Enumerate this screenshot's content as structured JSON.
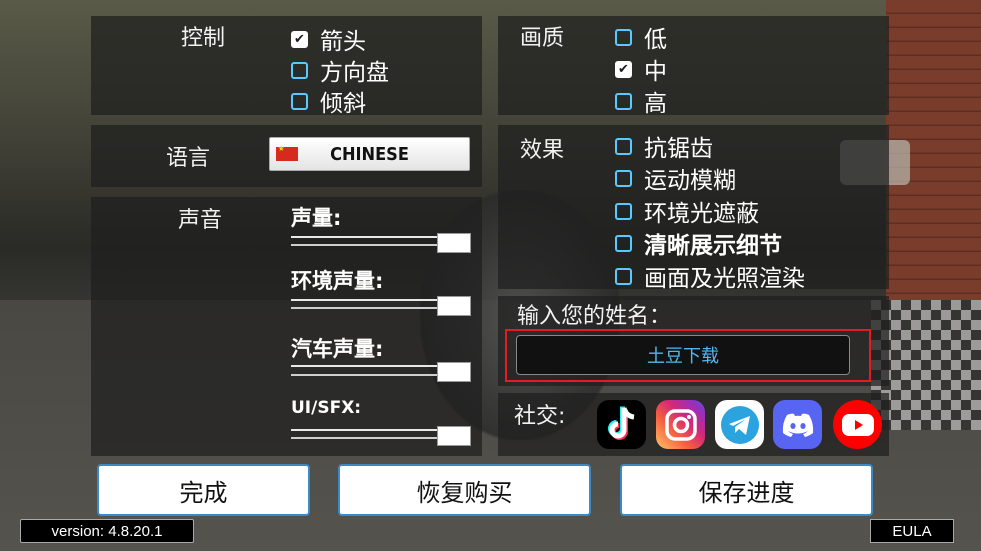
{
  "controls": {
    "label": "控制",
    "options": [
      {
        "label": "箭头",
        "checked": true
      },
      {
        "label": "方向盘",
        "checked": false
      },
      {
        "label": "倾斜",
        "checked": false
      }
    ]
  },
  "quality": {
    "label": "画质",
    "options": [
      {
        "label": "低",
        "checked": false
      },
      {
        "label": "中",
        "checked": true
      },
      {
        "label": "高",
        "checked": false
      }
    ]
  },
  "language": {
    "label": "语言",
    "value": "CHINESE"
  },
  "effects": {
    "label": "效果",
    "options": [
      {
        "label": "抗锯齿",
        "checked": false
      },
      {
        "label": "运动模糊",
        "checked": false
      },
      {
        "label": "环境光遮蔽",
        "checked": false
      },
      {
        "label": "清晰展示细节",
        "checked": false
      },
      {
        "label": "画面及光照渲染",
        "checked": false
      }
    ]
  },
  "sound": {
    "label": "声音",
    "sliders": [
      {
        "label": "声量:",
        "level": 1.0
      },
      {
        "label": "环境声量:",
        "level": 1.0
      },
      {
        "label": "汽车声量:",
        "level": 1.0
      },
      {
        "label": "UI/SFX:",
        "level": 1.0
      }
    ]
  },
  "name_input": {
    "label": "输入您的姓名：",
    "value": "土豆下载"
  },
  "social": {
    "label": "社交:",
    "icons": [
      "tiktok-icon",
      "instagram-icon",
      "telegram-icon",
      "discord-icon",
      "youtube-icon"
    ]
  },
  "buttons": {
    "done": "完成",
    "restore": "恢复购买",
    "save": "保存进度"
  },
  "footer": {
    "version": "version: 4.8.20.1",
    "eula": "EULA"
  },
  "colors": {
    "accent": "#5bc8ff",
    "highlight_box": "#e31b23",
    "button_border": "#3b8ac6"
  }
}
